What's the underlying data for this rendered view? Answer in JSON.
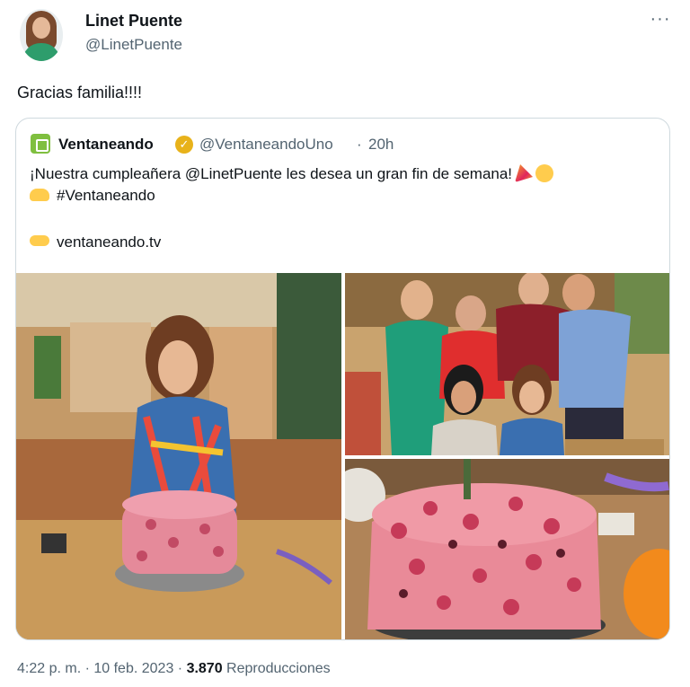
{
  "author": {
    "name": "Linet Puente",
    "handle": "@LinetPuente"
  },
  "tweet": {
    "text": "Gracias familia!!!!"
  },
  "quoted_tweet": {
    "name": "Ventaneando",
    "handle": "@VentaneandoUno",
    "separator": "·",
    "time": "20h",
    "line1": "¡Nuestra cumpleañera @LinetPuente les desea un gran fin de semana!",
    "line2": "#Ventaneando",
    "line3": "ventaneando.tv"
  },
  "footer": {
    "timestamp": "4:22 p. m. · 10 feb. 2023 · ",
    "views_count": "3.870",
    "views_label": " Reproducciones"
  },
  "colors": {
    "text_primary": "#0f1419",
    "text_secondary": "#536471",
    "border": "#cfd9de",
    "verified_badge": "#e8b21a"
  }
}
